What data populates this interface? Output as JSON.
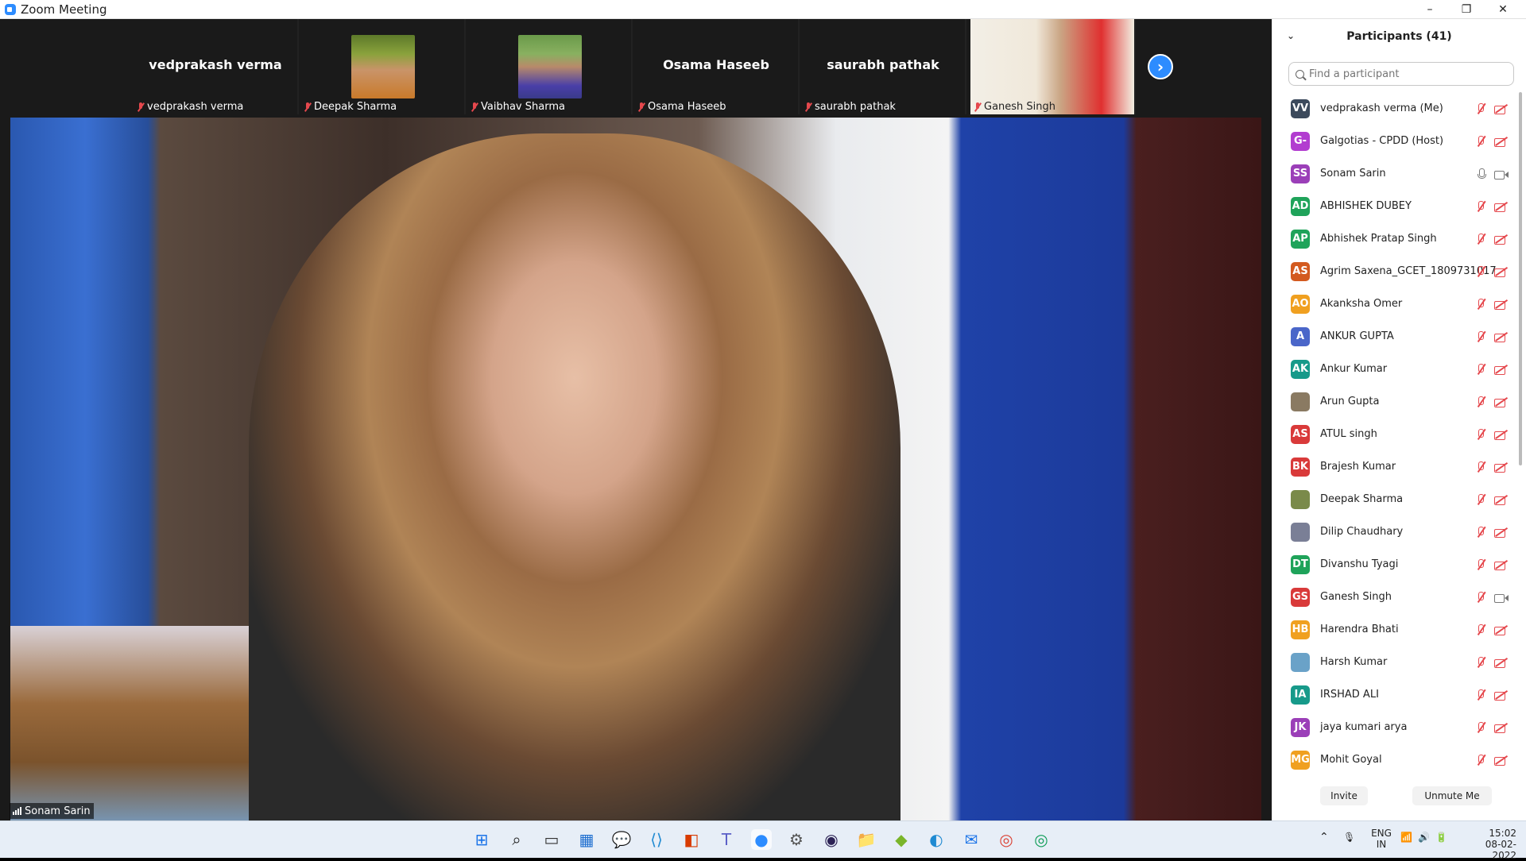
{
  "window": {
    "title": "Zoom Meeting",
    "minimize": "–",
    "maximize": "❐",
    "close": "✕"
  },
  "strip": {
    "tiles": [
      {
        "big_name": "vedprakash verma",
        "label": "vedprakash verma"
      },
      {
        "big_name": "",
        "label": "Deepak Sharma"
      },
      {
        "big_name": "",
        "label": "Vaibhav Sharma"
      },
      {
        "big_name": "Osama Haseeb",
        "label": "Osama Haseeb"
      },
      {
        "big_name": "saurabh pathak",
        "label": "saurabh pathak"
      },
      {
        "big_name": "",
        "label": "Ganesh Singh"
      }
    ],
    "next_glyph": "›"
  },
  "main": {
    "speaker_label": "Sonam Sarin"
  },
  "participants": {
    "header": "Participants (41)",
    "collapse_glyph": "⌄",
    "search_placeholder": "Find a participant",
    "list": [
      {
        "initials": "VV",
        "name": "vedprakash verma (Me)",
        "color": "#3c4a5c",
        "mic": "off",
        "cam": "off"
      },
      {
        "initials": "G-",
        "name": "Galgotias - CPDD (Host)",
        "color": "#b23dd0",
        "mic": "off",
        "cam": "off"
      },
      {
        "initials": "SS",
        "name": "Sonam Sarin",
        "color": "#9b3fb8",
        "mic": "on",
        "cam": "on"
      },
      {
        "initials": "AD",
        "name": "ABHISHEK DUBEY",
        "color": "#1fa35a",
        "mic": "off",
        "cam": "off"
      },
      {
        "initials": "AP",
        "name": "Abhishek Pratap Singh",
        "color": "#1fa35a",
        "mic": "off",
        "cam": "off"
      },
      {
        "initials": "AS",
        "name": "Agrim Saxena_GCET_1809731017",
        "color": "#d35a1f",
        "mic": "off",
        "cam": "off"
      },
      {
        "initials": "AO",
        "name": "Akanksha Omer",
        "color": "#f0a020",
        "mic": "off",
        "cam": "off"
      },
      {
        "initials": "A",
        "name": "ANKUR GUPTA",
        "color": "#4a66c9",
        "mic": "off",
        "cam": "off"
      },
      {
        "initials": "AK",
        "name": "Ankur Kumar",
        "color": "#179a8a",
        "mic": "off",
        "cam": "off"
      },
      {
        "initials": "",
        "name": "Arun Gupta",
        "color": "#8a7a62",
        "mic": "off",
        "cam": "off"
      },
      {
        "initials": "AS",
        "name": "ATUL singh",
        "color": "#d93a3a",
        "mic": "off",
        "cam": "off"
      },
      {
        "initials": "BK",
        "name": "Brajesh Kumar",
        "color": "#d93a3a",
        "mic": "off",
        "cam": "off"
      },
      {
        "initials": "",
        "name": "Deepak Sharma",
        "color": "#7a8a4a",
        "mic": "off",
        "cam": "off"
      },
      {
        "initials": "",
        "name": "Dilip Chaudhary",
        "color": "#7a7f96",
        "mic": "off",
        "cam": "off"
      },
      {
        "initials": "DT",
        "name": "Divanshu Tyagi",
        "color": "#1fa35a",
        "mic": "off",
        "cam": "off"
      },
      {
        "initials": "GS",
        "name": "Ganesh Singh",
        "color": "#d93a3a",
        "mic": "off",
        "cam": "on"
      },
      {
        "initials": "HB",
        "name": "Harendra Bhati",
        "color": "#f0a020",
        "mic": "off",
        "cam": "off"
      },
      {
        "initials": "",
        "name": "Harsh Kumar",
        "color": "#6aa2c8",
        "mic": "off",
        "cam": "off"
      },
      {
        "initials": "IA",
        "name": "IRSHAD ALI",
        "color": "#179a8a",
        "mic": "off",
        "cam": "off"
      },
      {
        "initials": "JK",
        "name": "jaya kumari arya",
        "color": "#9b3fb8",
        "mic": "off",
        "cam": "off"
      },
      {
        "initials": "MG",
        "name": "Mohit Goyal",
        "color": "#f0a020",
        "mic": "off",
        "cam": "off"
      }
    ],
    "invite_label": "Invite",
    "unmute_label": "Unmute Me"
  },
  "taskbar": {
    "icons": [
      "windows-start-icon",
      "search-icon",
      "task-view-icon",
      "widgets-icon",
      "chat-icon",
      "vscode-icon",
      "office-icon",
      "teams-icon",
      "zoom-icon",
      "settings-icon",
      "eclipse-icon",
      "file-explorer-icon",
      "bluestacks-icon",
      "edge-icon",
      "mail-icon",
      "chrome-icon",
      "chrome-profile-icon"
    ],
    "lang_line1": "ENG",
    "lang_line2": "IN",
    "time": "15:02",
    "date": "08-02-2022",
    "chevron": "⌃"
  },
  "colors": {
    "accent": "#2d8cff",
    "muted_red": "#e5484d"
  }
}
